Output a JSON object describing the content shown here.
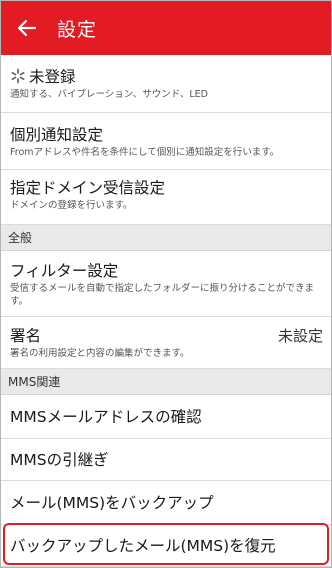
{
  "header": {
    "title": "設定",
    "back_icon": "arrow-left-icon",
    "bg": "#e31b23"
  },
  "items": {
    "notify": {
      "title": "未登録",
      "subtitle": "通知する、バイブレーション、サウンド、LED",
      "icon": "loading-spinner-icon"
    },
    "individual": {
      "title": "個別通知設定",
      "subtitle": "Fromアドレスや件名を条件にして個別に通知設定を行います。"
    },
    "domain": {
      "title": "指定ドメイン受信設定",
      "subtitle": "ドメインの登録を行います。"
    },
    "filter": {
      "title": "フィルター設定",
      "subtitle": "受信するメールを自動で指定したフォルダーに振り分けることができます。"
    },
    "signature": {
      "title": "署名",
      "subtitle": "署名の利用設定と内容の編集ができます。",
      "value": "未設定"
    },
    "mms_address": {
      "title": "MMSメールアドレスの確認"
    },
    "mms_transfer": {
      "title": "MMSの引継ぎ"
    },
    "backup": {
      "title": "メール(MMS)をバックアップ"
    },
    "restore": {
      "title": "バックアップしたメール(MMS)を復元"
    }
  },
  "sections": {
    "general": "全般",
    "mms": "MMS関連"
  },
  "highlight_color": "#e31b23"
}
